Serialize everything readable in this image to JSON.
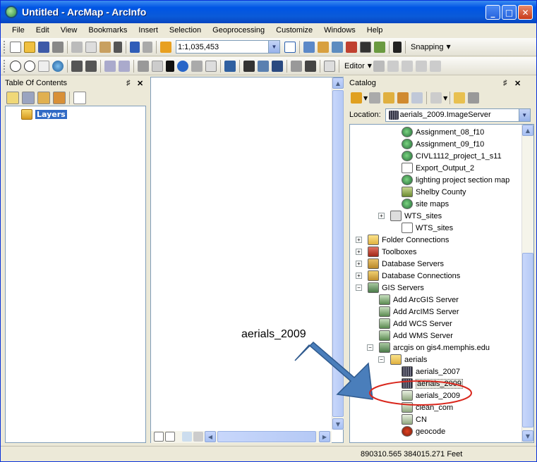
{
  "window": {
    "title": "Untitled - ArcMap - ArcInfo"
  },
  "menu": [
    "File",
    "Edit",
    "View",
    "Bookmarks",
    "Insert",
    "Selection",
    "Geoprocessing",
    "Customize",
    "Windows",
    "Help"
  ],
  "toolbar": {
    "scale_value": "1:1,035,453",
    "snapping_label": "Snapping",
    "editor_label": "Editor"
  },
  "toc": {
    "title": "Table Of Contents",
    "layers_label": "Layers"
  },
  "catalog": {
    "title": "Catalog",
    "location_label": "Location:",
    "location_value": "aerials_2009.ImageServer",
    "items": [
      {
        "label": "Assignment_08_f10",
        "icon": "map-document-icon"
      },
      {
        "label": "Assignment_09_f10",
        "icon": "map-document-icon"
      },
      {
        "label": "CIVL1112_project_1_s11",
        "icon": "map-document-icon"
      },
      {
        "label": "Export_Output_2",
        "icon": "table-icon"
      },
      {
        "label": "lighting project section map",
        "icon": "map-document-icon"
      },
      {
        "label": "Shelby County",
        "icon": "layer-icon"
      },
      {
        "label": "site maps",
        "icon": "map-document-icon"
      },
      {
        "label": "WTS_sites",
        "icon": "feature-class-icon"
      },
      {
        "label": "WTS_sites",
        "icon": "table-icon"
      },
      {
        "label": "Folder Connections",
        "icon": "folder-icon"
      },
      {
        "label": "Toolboxes",
        "icon": "toolbox-icon"
      },
      {
        "label": "Database Servers",
        "icon": "database-server-icon"
      },
      {
        "label": "Database Connections",
        "icon": "database-icon"
      },
      {
        "label": "GIS Servers",
        "icon": "server-icon"
      },
      {
        "label": "Add ArcGIS Server",
        "icon": "add-server-icon"
      },
      {
        "label": "Add ArcIMS Server",
        "icon": "add-server-icon"
      },
      {
        "label": "Add WCS Server",
        "icon": "add-server-icon"
      },
      {
        "label": "Add WMS Server",
        "icon": "add-server-icon"
      },
      {
        "label": "arcgis on gis4.memphis.edu",
        "icon": "server-icon"
      },
      {
        "label": "aerials",
        "icon": "folder-icon"
      },
      {
        "label": "aerials_2007",
        "icon": "image-service-icon"
      },
      {
        "label": "aerials_2009",
        "icon": "image-service-icon"
      },
      {
        "label": "aerials_2009",
        "icon": "map-service-icon"
      },
      {
        "label": "clean_com",
        "icon": "map-service-icon"
      },
      {
        "label": "CN",
        "icon": "map-service-icon"
      },
      {
        "label": "geocode",
        "icon": "geocode-service-icon"
      }
    ]
  },
  "status": {
    "coordinates": "890310.565  384015.271 Feet"
  },
  "annotation": {
    "label": "aerials_2009",
    "arrow_color": "#4a7ebb",
    "circle_color": "#d9261c"
  }
}
